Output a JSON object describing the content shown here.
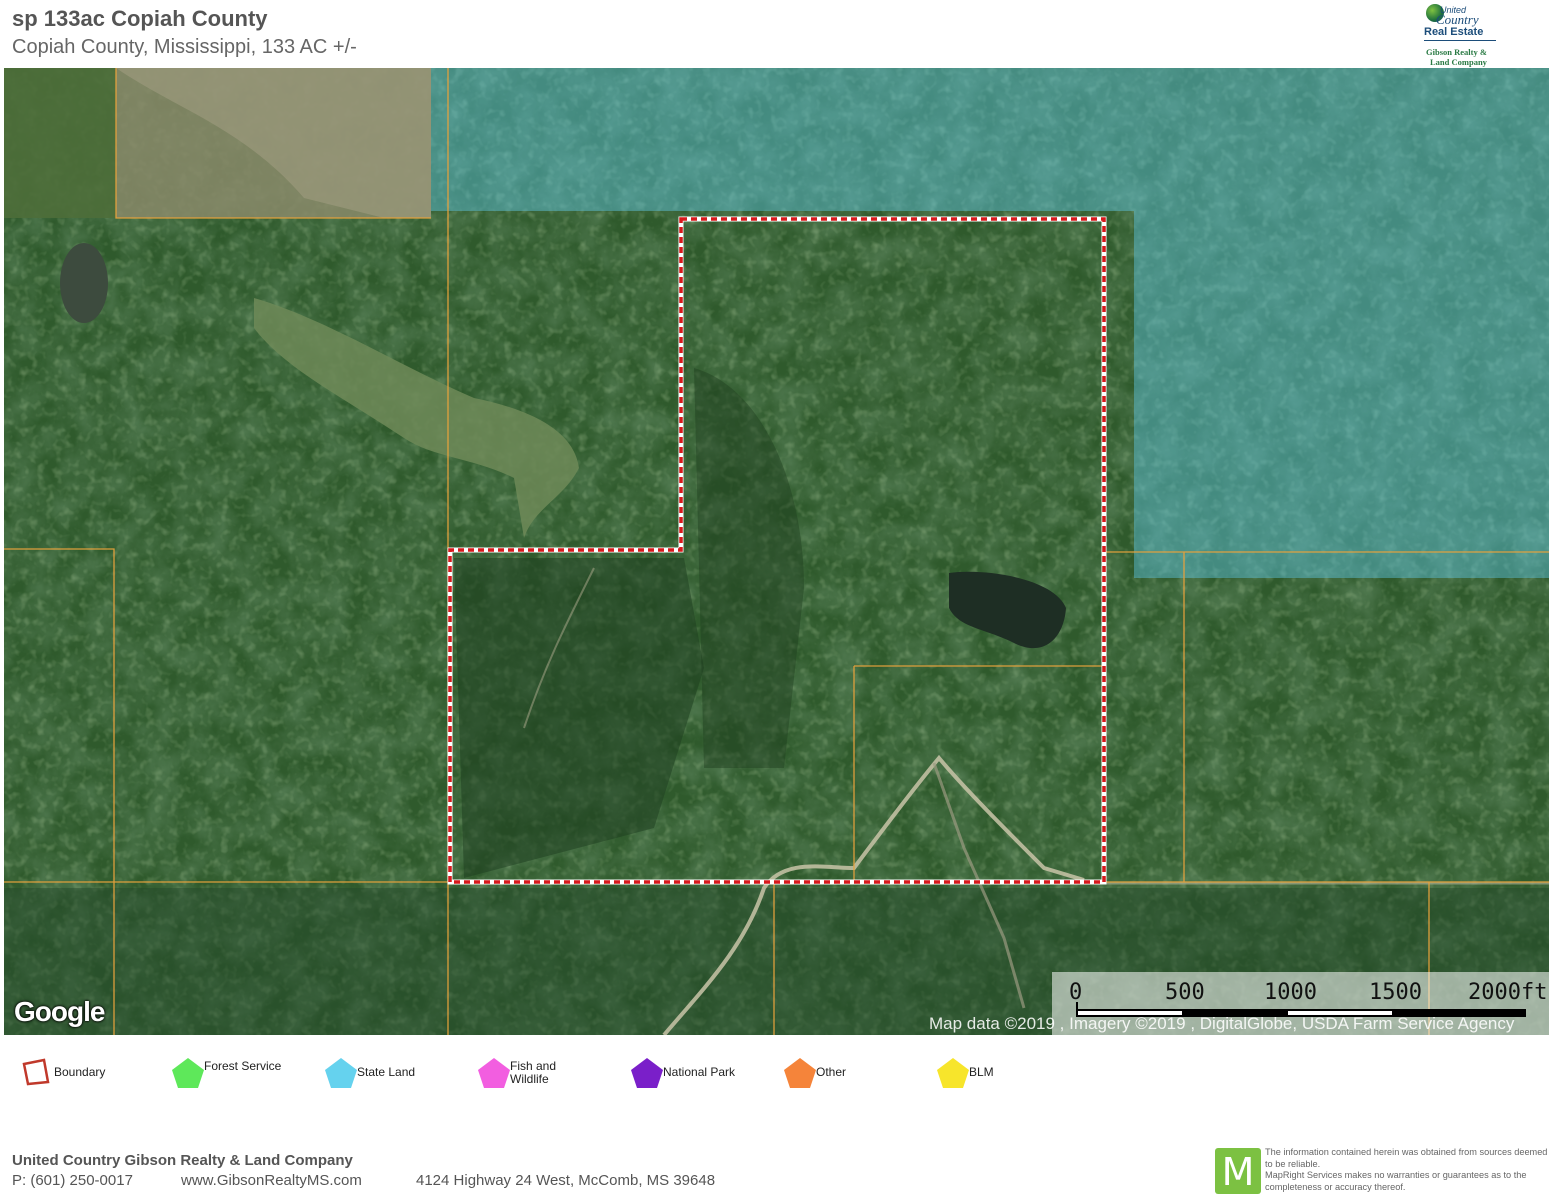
{
  "header": {
    "title": "sp 133ac Copiah County",
    "subtitle": "Copiah County, Mississippi, 133 AC +/-"
  },
  "logo": {
    "line1": "United",
    "line2": "Country",
    "line3": "Real Estate",
    "line4": "Gibson Realty &",
    "line5": "Land Company"
  },
  "map": {
    "provider_logo": "Google",
    "attribution": "Map data ©2019 , Imagery ©2019 , DigitalGlobe, USDA Farm Service Agency",
    "scale_labels": [
      "0",
      "500",
      "1000",
      "1500",
      "2000ft"
    ],
    "colors": {
      "boundary": "#d7191c",
      "parcel_lines": "#e8a23c",
      "state_land_overlay": "#5fc8e6"
    }
  },
  "legend": {
    "items": [
      {
        "label": "Boundary",
        "color": "#c0392b",
        "icon": "boundary-outline-icon"
      },
      {
        "label": "Forest Service",
        "color": "#5ee85a",
        "icon": "pentagon-icon"
      },
      {
        "label": "State Land",
        "color": "#65d2ee",
        "icon": "pentagon-icon"
      },
      {
        "label": "Fish and\nWildlife",
        "color": "#f25ee0",
        "icon": "pentagon-icon"
      },
      {
        "label": "National Park",
        "color": "#7a1fc9",
        "icon": "pentagon-icon"
      },
      {
        "label": "Other",
        "color": "#f5843a",
        "icon": "pentagon-icon"
      },
      {
        "label": "BLM",
        "color": "#f7e52b",
        "icon": "pentagon-icon"
      }
    ]
  },
  "footer": {
    "company": "United Country  Gibson Realty & Land Company",
    "phone": "P: (601) 250-0017",
    "website": "www.GibsonRealtyMS.com",
    "address": "4124 Highway 24 West, McComb, MS 39648",
    "maprigh_logo_letter": "M",
    "disclaimer": "The information contained herein was obtained from sources deemed to be reliable.\nMapRight Services makes no warranties or guarantees as to the completeness or accuracy thereof."
  }
}
